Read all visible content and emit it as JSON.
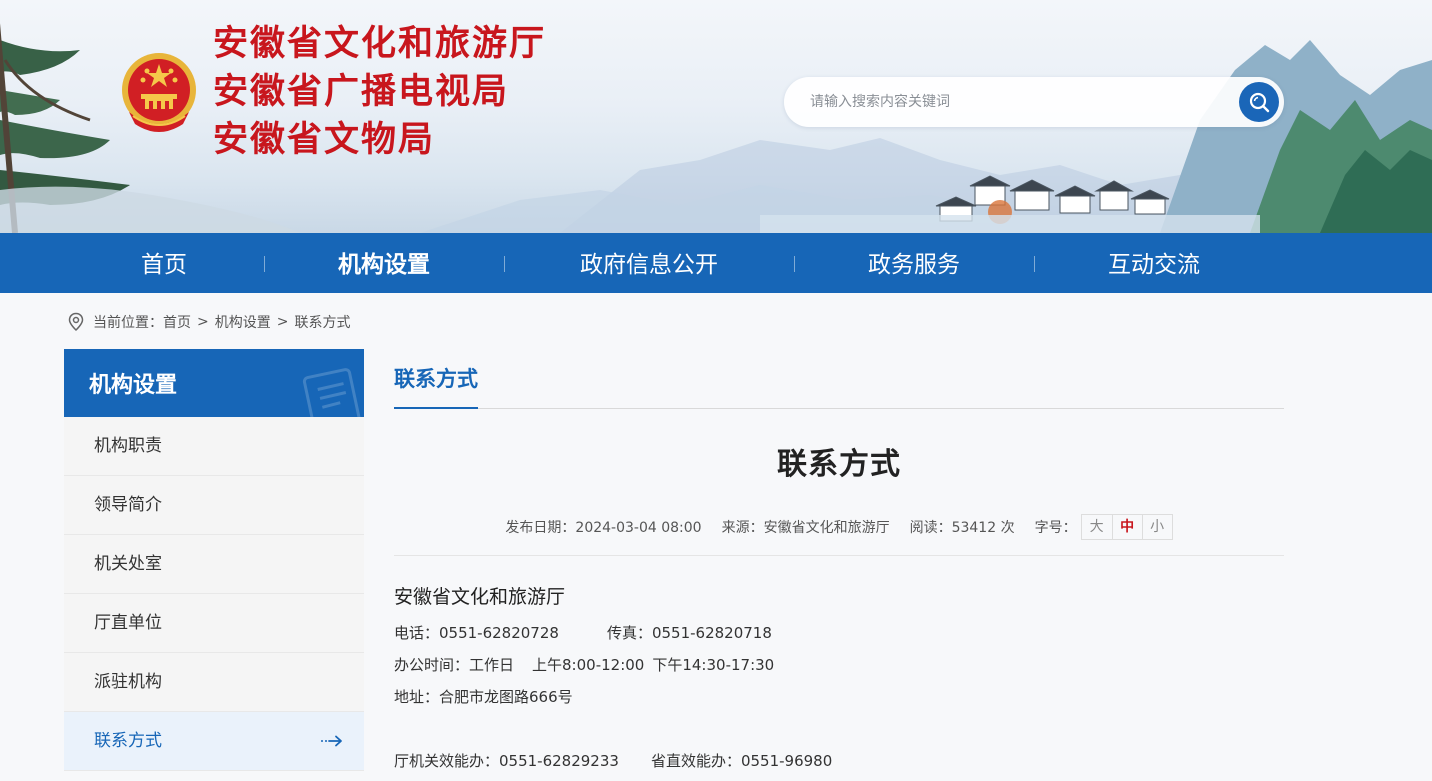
{
  "header": {
    "org_titles": [
      "安徽省文化和旅游厅",
      "安徽省广播电视局",
      "安徽省文物局"
    ],
    "search": {
      "placeholder": "请输入搜索内容关键词"
    },
    "icons": {
      "emblem": "national-emblem-icon",
      "search": "search-icon"
    }
  },
  "nav": {
    "items": [
      {
        "label": "首页",
        "active": false
      },
      {
        "label": "机构设置",
        "active": true
      },
      {
        "label": "政府信息公开",
        "active": false
      },
      {
        "label": "政务服务",
        "active": false
      },
      {
        "label": "互动交流",
        "active": false
      }
    ]
  },
  "breadcrumb": {
    "prefix": "当前位置：",
    "items": [
      "首页",
      "机构设置",
      "联系方式"
    ],
    "separator": ">"
  },
  "sidebar": {
    "title": "机构设置",
    "items": [
      {
        "label": "机构职责",
        "active": false
      },
      {
        "label": "领导简介",
        "active": false
      },
      {
        "label": "机关处室",
        "active": false
      },
      {
        "label": "厅直单位",
        "active": false
      },
      {
        "label": "派驻机构",
        "active": false
      },
      {
        "label": "联系方式",
        "active": true
      }
    ]
  },
  "main": {
    "tab_label": "联系方式",
    "article": {
      "title": "联系方式",
      "meta": {
        "date_label": "发布日期：",
        "date": "2024-03-04 08:00",
        "source_label": "来源：",
        "source": "安徽省文化和旅游厅",
        "reads_label": "阅读：",
        "reads": "53412 次",
        "font_label": "字号：",
        "font_sizes": [
          "大",
          "中",
          "小"
        ],
        "font_selected": "中"
      },
      "org_name": "安徽省文化和旅游厅",
      "phone": "电话：0551-62820728",
      "fax": "传真：0551-62820718",
      "hours_label": "办公时间：工作日",
      "hours_am": "上午8:00-12:00",
      "hours_pm": "下午14:30-17:30",
      "address": "地址：合肥市龙图路666号",
      "efficiency_office": "厅机关效能办：0551-62829233",
      "provincial_efficiency_office": "省直效能办：0551-96980"
    }
  },
  "colors": {
    "brand_blue": "#1766b7",
    "title_red": "#c8161d",
    "active_font_red": "#c8161d"
  }
}
